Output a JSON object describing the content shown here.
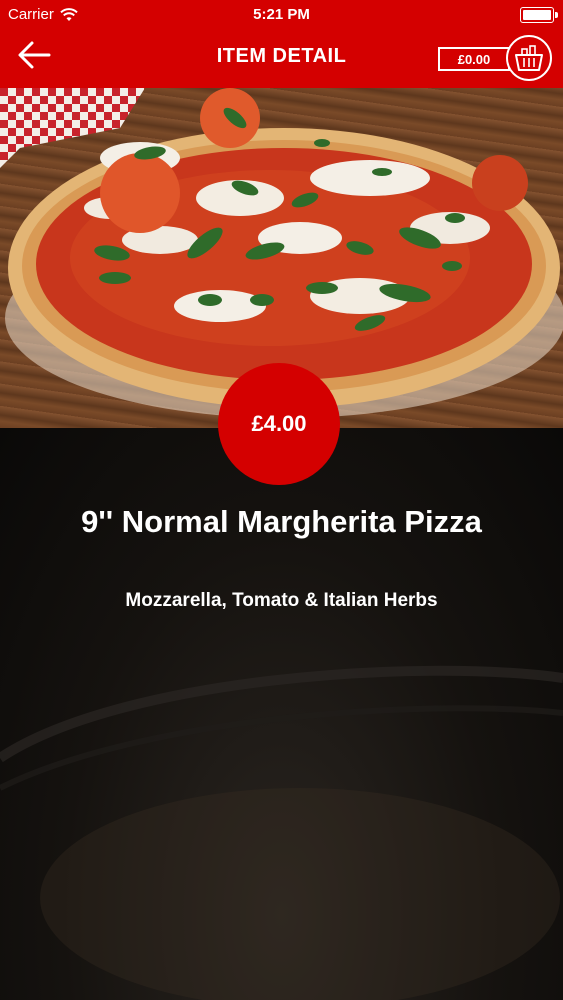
{
  "status_bar": {
    "carrier": "Carrier",
    "time": "5:21 PM",
    "wifi_icon": "wifi-icon",
    "battery_icon": "battery-icon"
  },
  "nav": {
    "back_icon": "arrow-left-icon",
    "title": "ITEM DETAIL",
    "cart_amount": "£0.00",
    "cart_icon": "basket-icon"
  },
  "item": {
    "price": "£4.00",
    "name": "9'' Normal  Margherita Pizza",
    "description": "Mozzarella, Tomato & Italian Herbs"
  },
  "colors": {
    "brand_red": "#d40000",
    "text": "#ffffff",
    "background_dark": "#0e0c0a"
  }
}
